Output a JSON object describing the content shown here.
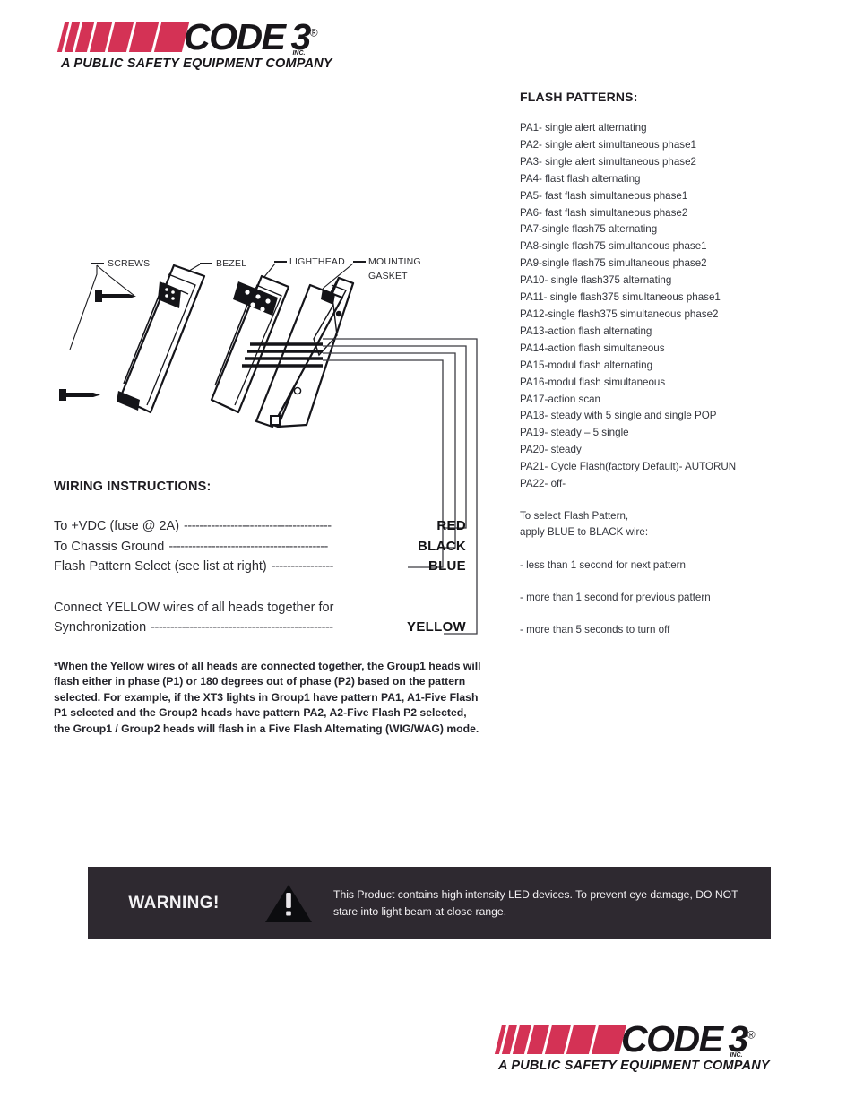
{
  "brand": {
    "name": "CODE 3",
    "word_code": "CODE",
    "word_three": "3",
    "inc_mark": "INC.",
    "registered_mark": "®",
    "tagline": "A PUBLIC SAFETY EQUIPMENT COMPANY",
    "stripe_color": "#D43255",
    "text_color": "#18161a"
  },
  "flash_patterns": {
    "title": "FLASH PATTERNS:",
    "items": [
      "PA1- single alert alternating",
      "PA2- single alert simultaneous phase1",
      "PA3- single alert simultaneous phase2",
      "PA4- flast flash alternating",
      "PA5- fast flash simultaneous phase1",
      "PA6- fast flash simultaneous phase2",
      "PA7-single flash75 alternating",
      "PA8-single flash75 simultaneous phase1",
      "PA9-single flash75 simultaneous phase2",
      "PA10- single flash375 alternating",
      "PA11- single flash375 simultaneous phase1",
      "PA12-single flash375 simultaneous phase2",
      "PA13-action flash alternating",
      "PA14-action flash simultaneous",
      "PA15-modul flash alternating",
      "PA16-modul flash simultaneous",
      "PA17-action scan",
      "PA18- steady with 5 single and single POP",
      "PA19- steady – 5 single",
      "PA20- steady",
      "PA21- Cycle Flash(factory Default)- AUTORUN",
      "PA22- off-"
    ],
    "select_note": [
      "To select Flash Pattern,",
      "apply BLUE to BLACK wire:"
    ],
    "bullets": [
      "-  less than 1 second for next pattern",
      "-  more than 1 second for previous pattern",
      "-  more than 5 seconds to turn off"
    ]
  },
  "diagram": {
    "labels": {
      "screws": "SCREWS",
      "bezel": "BEZEL",
      "lighthead": "LIGHTHEAD",
      "gasket_line1": "MOUNTING",
      "gasket_line2": "GASKET"
    }
  },
  "wiring": {
    "title": "WIRING INSTRUCTIONS:",
    "rows": [
      {
        "description": "To +VDC (fuse @ 2A)",
        "dashes": "--------------------------------------",
        "color_label": "RED"
      },
      {
        "description": "To Chassis Ground",
        "dashes": "-----------------------------------------",
        "color_label": "BLACK"
      },
      {
        "description": "Flash Pattern Select (see list at right)",
        "dashes": "----------------",
        "color_label": "BLUE"
      }
    ],
    "sync_text": "Connect YELLOW wires of all heads together for",
    "sync_row": {
      "description": "Synchronization",
      "dashes": "-----------------------------------------------",
      "color_label": "YELLOW"
    }
  },
  "footnote": "*When the Yellow wires of all heads are connected together, the Group1 heads will flash either in phase (P1) or 180 degrees out of phase (P2) based on the pattern selected.  For example, if the XT3 lights in Group1 have pattern PA1, A1-Five Flash P1 selected and the Group2 heads have pattern PA2, A2-Five Flash P2 selected, the Group1 / Group2 heads will flash in a Five Flash Alternating (WIG/WAG) mode.",
  "warning": {
    "label": "WARNING!",
    "icon": "warning-triangle-icon",
    "text": "This Product contains high intensity LED devices.  To prevent eye damage, DO NOT stare into light beam at close range.",
    "background_color": "#2E2930",
    "text_color": "#f4f2f4"
  }
}
